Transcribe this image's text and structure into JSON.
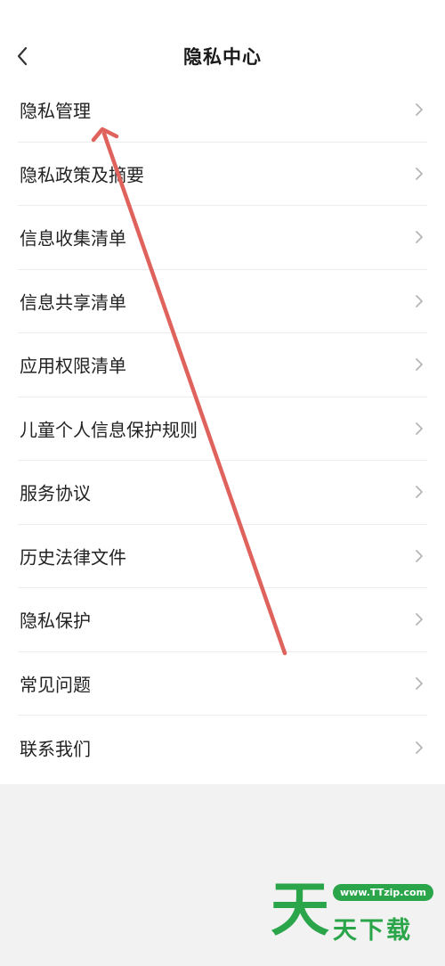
{
  "header": {
    "title": "隐私中心",
    "back_icon": "chevron-left-icon"
  },
  "menu": {
    "items": [
      {
        "label": "隐私管理"
      },
      {
        "label": "隐私政策及摘要"
      },
      {
        "label": "信息收集清单"
      },
      {
        "label": "信息共享清单"
      },
      {
        "label": "应用权限清单"
      },
      {
        "label": "儿童个人信息保护规则"
      },
      {
        "label": "服务协议"
      },
      {
        "label": "历史法律文件"
      },
      {
        "label": "隐私保护"
      },
      {
        "label": "常见问题"
      },
      {
        "label": "联系我们"
      }
    ],
    "chevron_icon": "chevron-right-icon"
  },
  "annotation": {
    "type": "arrow",
    "color": "#e0625c",
    "points_to": "隐私管理"
  },
  "watermark": {
    "big_char": "天",
    "url": "www.TTzip.com",
    "text": "天下载",
    "color": "#2aa54a"
  },
  "colors": {
    "panel_background": "#ffffff",
    "page_background": "#f2f2f2",
    "divider": "#ececec",
    "text": "#222222",
    "chevron": "#b5b5b5"
  }
}
